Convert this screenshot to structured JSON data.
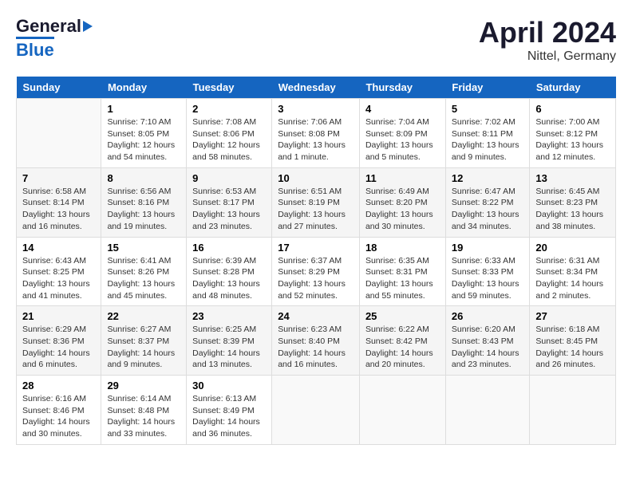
{
  "header": {
    "logo_line1": "General",
    "logo_line2": "Blue",
    "title": "April 2024",
    "subtitle": "Nittel, Germany"
  },
  "columns": [
    "Sunday",
    "Monday",
    "Tuesday",
    "Wednesday",
    "Thursday",
    "Friday",
    "Saturday"
  ],
  "weeks": [
    [
      {
        "num": "",
        "info": ""
      },
      {
        "num": "1",
        "info": "Sunrise: 7:10 AM\nSunset: 8:05 PM\nDaylight: 12 hours\nand 54 minutes."
      },
      {
        "num": "2",
        "info": "Sunrise: 7:08 AM\nSunset: 8:06 PM\nDaylight: 12 hours\nand 58 minutes."
      },
      {
        "num": "3",
        "info": "Sunrise: 7:06 AM\nSunset: 8:08 PM\nDaylight: 13 hours\nand 1 minute."
      },
      {
        "num": "4",
        "info": "Sunrise: 7:04 AM\nSunset: 8:09 PM\nDaylight: 13 hours\nand 5 minutes."
      },
      {
        "num": "5",
        "info": "Sunrise: 7:02 AM\nSunset: 8:11 PM\nDaylight: 13 hours\nand 9 minutes."
      },
      {
        "num": "6",
        "info": "Sunrise: 7:00 AM\nSunset: 8:12 PM\nDaylight: 13 hours\nand 12 minutes."
      }
    ],
    [
      {
        "num": "7",
        "info": "Sunrise: 6:58 AM\nSunset: 8:14 PM\nDaylight: 13 hours\nand 16 minutes."
      },
      {
        "num": "8",
        "info": "Sunrise: 6:56 AM\nSunset: 8:16 PM\nDaylight: 13 hours\nand 19 minutes."
      },
      {
        "num": "9",
        "info": "Sunrise: 6:53 AM\nSunset: 8:17 PM\nDaylight: 13 hours\nand 23 minutes."
      },
      {
        "num": "10",
        "info": "Sunrise: 6:51 AM\nSunset: 8:19 PM\nDaylight: 13 hours\nand 27 minutes."
      },
      {
        "num": "11",
        "info": "Sunrise: 6:49 AM\nSunset: 8:20 PM\nDaylight: 13 hours\nand 30 minutes."
      },
      {
        "num": "12",
        "info": "Sunrise: 6:47 AM\nSunset: 8:22 PM\nDaylight: 13 hours\nand 34 minutes."
      },
      {
        "num": "13",
        "info": "Sunrise: 6:45 AM\nSunset: 8:23 PM\nDaylight: 13 hours\nand 38 minutes."
      }
    ],
    [
      {
        "num": "14",
        "info": "Sunrise: 6:43 AM\nSunset: 8:25 PM\nDaylight: 13 hours\nand 41 minutes."
      },
      {
        "num": "15",
        "info": "Sunrise: 6:41 AM\nSunset: 8:26 PM\nDaylight: 13 hours\nand 45 minutes."
      },
      {
        "num": "16",
        "info": "Sunrise: 6:39 AM\nSunset: 8:28 PM\nDaylight: 13 hours\nand 48 minutes."
      },
      {
        "num": "17",
        "info": "Sunrise: 6:37 AM\nSunset: 8:29 PM\nDaylight: 13 hours\nand 52 minutes."
      },
      {
        "num": "18",
        "info": "Sunrise: 6:35 AM\nSunset: 8:31 PM\nDaylight: 13 hours\nand 55 minutes."
      },
      {
        "num": "19",
        "info": "Sunrise: 6:33 AM\nSunset: 8:33 PM\nDaylight: 13 hours\nand 59 minutes."
      },
      {
        "num": "20",
        "info": "Sunrise: 6:31 AM\nSunset: 8:34 PM\nDaylight: 14 hours\nand 2 minutes."
      }
    ],
    [
      {
        "num": "21",
        "info": "Sunrise: 6:29 AM\nSunset: 8:36 PM\nDaylight: 14 hours\nand 6 minutes."
      },
      {
        "num": "22",
        "info": "Sunrise: 6:27 AM\nSunset: 8:37 PM\nDaylight: 14 hours\nand 9 minutes."
      },
      {
        "num": "23",
        "info": "Sunrise: 6:25 AM\nSunset: 8:39 PM\nDaylight: 14 hours\nand 13 minutes."
      },
      {
        "num": "24",
        "info": "Sunrise: 6:23 AM\nSunset: 8:40 PM\nDaylight: 14 hours\nand 16 minutes."
      },
      {
        "num": "25",
        "info": "Sunrise: 6:22 AM\nSunset: 8:42 PM\nDaylight: 14 hours\nand 20 minutes."
      },
      {
        "num": "26",
        "info": "Sunrise: 6:20 AM\nSunset: 8:43 PM\nDaylight: 14 hours\nand 23 minutes."
      },
      {
        "num": "27",
        "info": "Sunrise: 6:18 AM\nSunset: 8:45 PM\nDaylight: 14 hours\nand 26 minutes."
      }
    ],
    [
      {
        "num": "28",
        "info": "Sunrise: 6:16 AM\nSunset: 8:46 PM\nDaylight: 14 hours\nand 30 minutes."
      },
      {
        "num": "29",
        "info": "Sunrise: 6:14 AM\nSunset: 8:48 PM\nDaylight: 14 hours\nand 33 minutes."
      },
      {
        "num": "30",
        "info": "Sunrise: 6:13 AM\nSunset: 8:49 PM\nDaylight: 14 hours\nand 36 minutes."
      },
      {
        "num": "",
        "info": ""
      },
      {
        "num": "",
        "info": ""
      },
      {
        "num": "",
        "info": ""
      },
      {
        "num": "",
        "info": ""
      }
    ]
  ]
}
